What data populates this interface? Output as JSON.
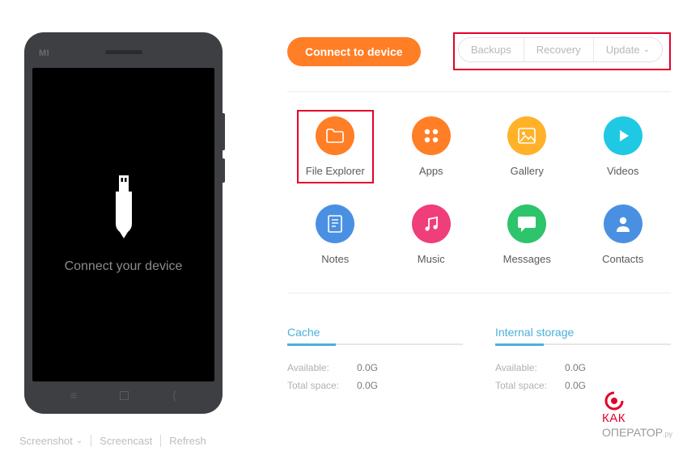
{
  "phone": {
    "brand": "MI",
    "prompt": "Connect your device"
  },
  "bottom_tools": {
    "screenshot": "Screenshot",
    "screencast": "Screencast",
    "refresh": "Refresh"
  },
  "top": {
    "connect_btn": "Connect to device",
    "pills": {
      "backups": "Backups",
      "recovery": "Recovery",
      "update": "Update"
    }
  },
  "tiles": {
    "file_explorer": "File Explorer",
    "apps": "Apps",
    "gallery": "Gallery",
    "videos": "Videos",
    "notes": "Notes",
    "music": "Music",
    "messages": "Messages",
    "contacts": "Contacts"
  },
  "storage": {
    "cache": {
      "title": "Cache",
      "available_label": "Available:",
      "available_value": "0.0G",
      "total_label": "Total space:",
      "total_value": "0.0G"
    },
    "internal": {
      "title": "Internal storage",
      "available_label": "Available:",
      "available_value": "0.0G",
      "total_label": "Total space:",
      "total_value": "0.0G"
    }
  },
  "watermark": {
    "line1": "КАК",
    "line2": "ОПЕРАТОР",
    "line3": ".ру"
  }
}
